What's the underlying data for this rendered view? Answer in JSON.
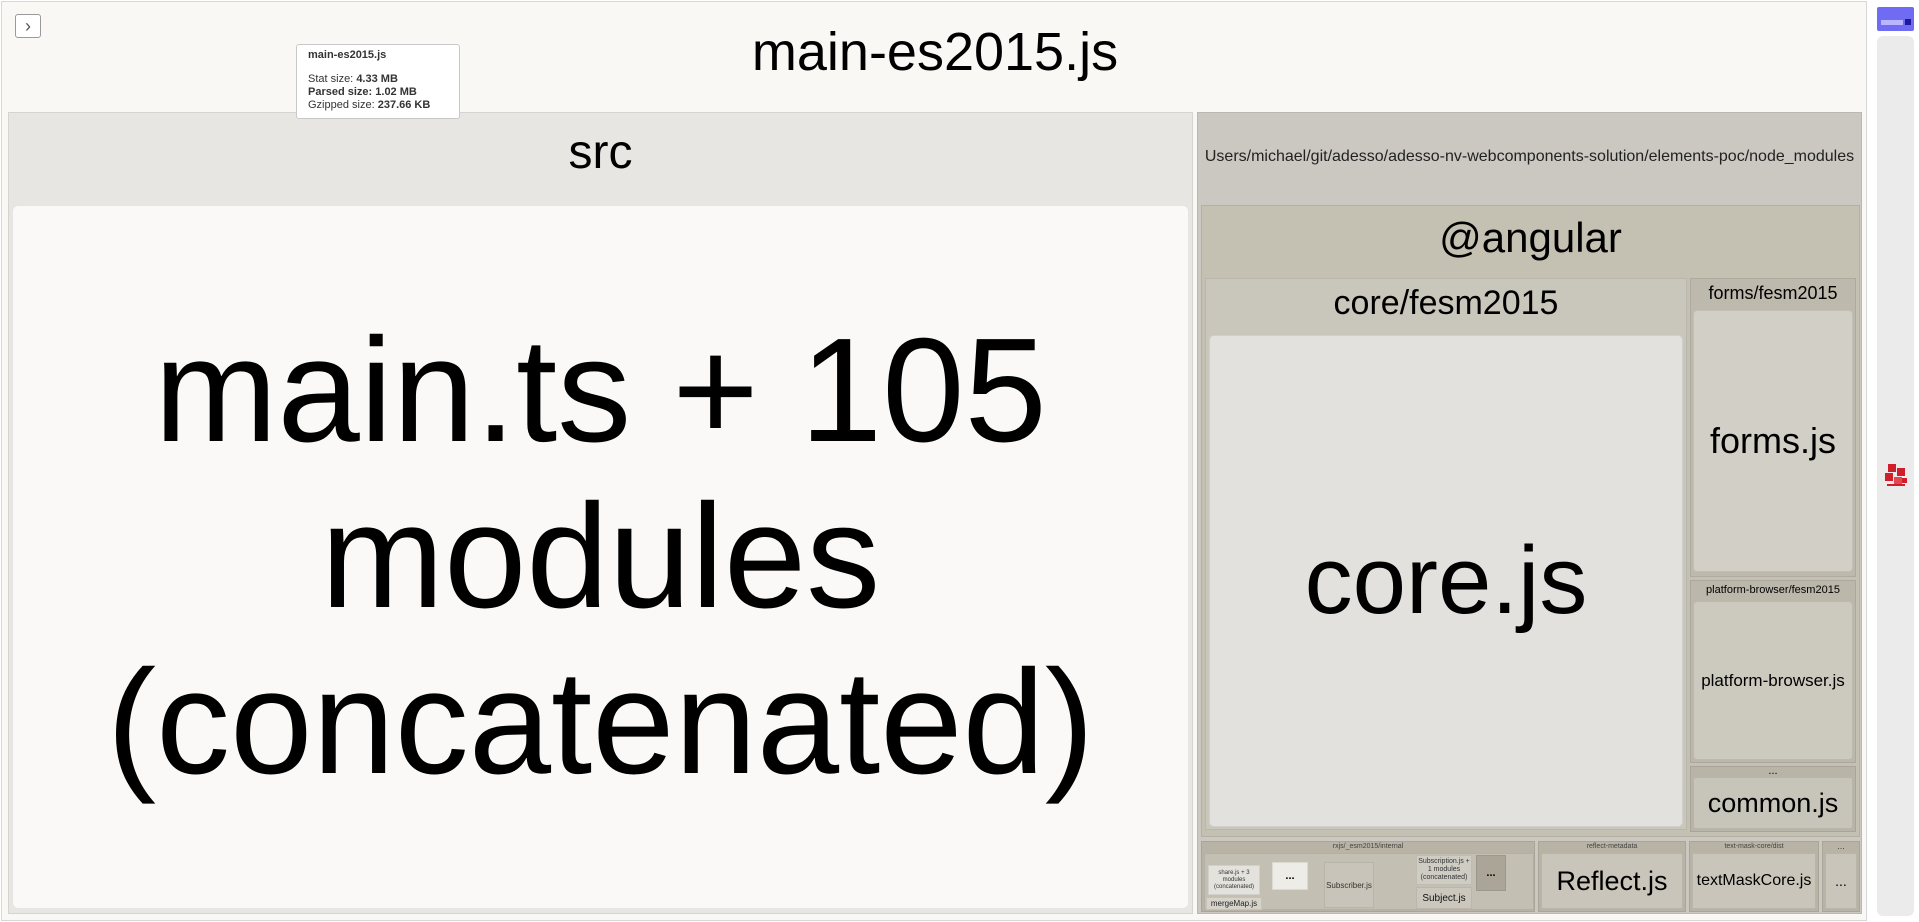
{
  "toggle": {
    "glyph": "›"
  },
  "page": {
    "title": "main-es2015.js"
  },
  "tooltip": {
    "file": "main-es2015.js",
    "stat_label": "Stat size:",
    "stat_value": "4.33 MB",
    "parsed_label": "Parsed size:",
    "parsed_value": "1.02 MB",
    "gzip_label": "Gzipped size:",
    "gzip_value": "237.66 KB"
  },
  "src": {
    "label": "src",
    "module_line1": "main.ts + 105",
    "module_line2": "modules",
    "module_line3": "(concatenated)"
  },
  "node_modules": {
    "path": "Users/michael/git/adesso/adesso-nv-webcomponents-solution/elements-poc/node_modules",
    "angular": {
      "label": "@angular",
      "core_folder": "core/fesm2015",
      "core_file": "core.js",
      "forms_folder": "forms/fesm2015",
      "forms_file": "forms.js",
      "pb_folder": "platform-browser/fesm2015",
      "pb_file": "platform-browser.js",
      "common_folder": "...",
      "common_file": "common.js"
    },
    "rxjs": {
      "label": "rxjs/_esm2015/internal",
      "share": "share.js + 3 modules (concatenated)",
      "mergemap": "mergeMap.js",
      "subscriber": "Subscriber.js",
      "subscription": "Subscription.js + 1 modules (concatenated)",
      "subject": "Subject.js",
      "ellipsis": "..."
    },
    "reflect": {
      "label": "reflect-metadata",
      "file": "Reflect.js"
    },
    "textmask": {
      "label": "text-mask-core/dist",
      "file": "textMaskCore.js"
    },
    "more": {
      "label": "...",
      "file": "..."
    }
  },
  "colors": {
    "src_header": "#e8e6e2",
    "src_module": "#faf9f7",
    "node_modules": "#cbc8c1",
    "angular": "#c4c0b2",
    "core": "#e2e1dd",
    "forms": "#d2cfc6",
    "small": "#b8b3a5",
    "minimap": "#6f6bf2"
  }
}
